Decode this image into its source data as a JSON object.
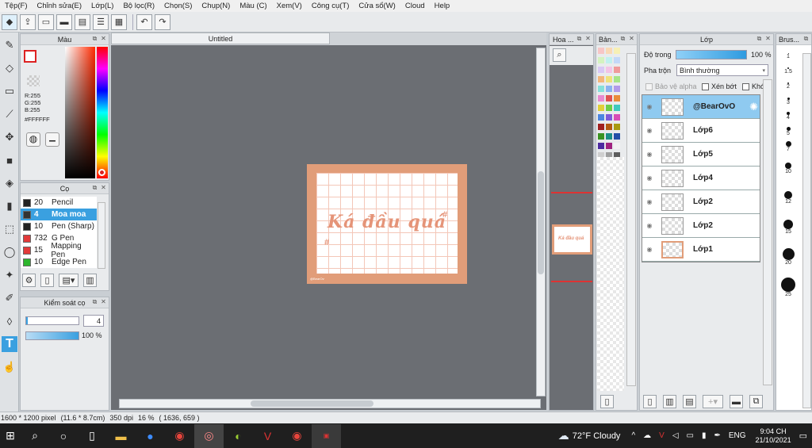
{
  "menu": [
    "Tệp(F)",
    "Chỉnh sửa(E)",
    "Lớp(L)",
    "Bộ lọc(R)",
    "Chọn(S)",
    "Chụp(N)",
    "Màu (C)",
    "Xem(V)",
    "Công cụ(T)",
    "Cửa sổ(W)",
    "Cloud",
    "Help"
  ],
  "document": {
    "tab_title": "Untitled",
    "artwork_text": "Ká đầu quá",
    "hash_mark": "#",
    "signature": "@BearOvO"
  },
  "color_panel": {
    "title": "Màu",
    "r": "R:255",
    "g": "G:255",
    "b": "B:255",
    "hex": "#FFFFFF"
  },
  "brush_panel": {
    "title": "Cọ",
    "brushes": [
      {
        "size": "20",
        "name": "Pencil",
        "color": "#222222"
      },
      {
        "size": "4",
        "name": "Moa moa",
        "color": "#333333"
      },
      {
        "size": "10",
        "name": "Pen (Sharp)",
        "color": "#222222"
      },
      {
        "size": "732",
        "name": "G Pen",
        "color": "#e23a3a"
      },
      {
        "size": "15",
        "name": "Mapping Pen",
        "color": "#e23a3a"
      },
      {
        "size": "10",
        "name": "Edge Pen",
        "color": "#2db52d"
      }
    ]
  },
  "brush_control": {
    "title": "Kiểm soát cọ",
    "size_value": "4",
    "opacity_value": "100 %"
  },
  "navigator": {
    "title": "Hoa ..."
  },
  "swatches": {
    "title": "Bản..."
  },
  "layer_panel": {
    "title": "Lớp",
    "opacity_label": "Độ trong",
    "opacity_value": "100 %",
    "blend_label": "Pha trộn",
    "blend_value": "Bình thường",
    "protect_alpha": "Bảo vệ alpha",
    "clipping": "Xén bớt",
    "lock": "Khóa",
    "layers": [
      "@BearOvO",
      "Lớp6",
      "Lớp5",
      "Lớp4",
      "Lớp2",
      "Lớp2",
      "Lớp1"
    ]
  },
  "brush_size_panel": {
    "title": "Brus...",
    "sizes": [
      "1",
      "1.5",
      "2",
      "3",
      "4",
      "5",
      "7",
      "10",
      "12",
      "15",
      "20",
      "25"
    ]
  },
  "status": {
    "dims": "1600 * 1200 pixel",
    "cm": "(11.6 * 8.7cm)",
    "dpi": "350 dpi",
    "zoom": "16 %",
    "coords": "( 1636, 659 )"
  },
  "taskbar": {
    "weather": "72°F Cloudy",
    "lang": "ENG",
    "time": "9:04 CH",
    "date": "21/10/2021"
  },
  "colors": {
    "accent": "#3aa0e0",
    "artwork_frame": "#e19d79",
    "artwork_text": "#e59478",
    "canvas_bg": "#6b6e73"
  }
}
